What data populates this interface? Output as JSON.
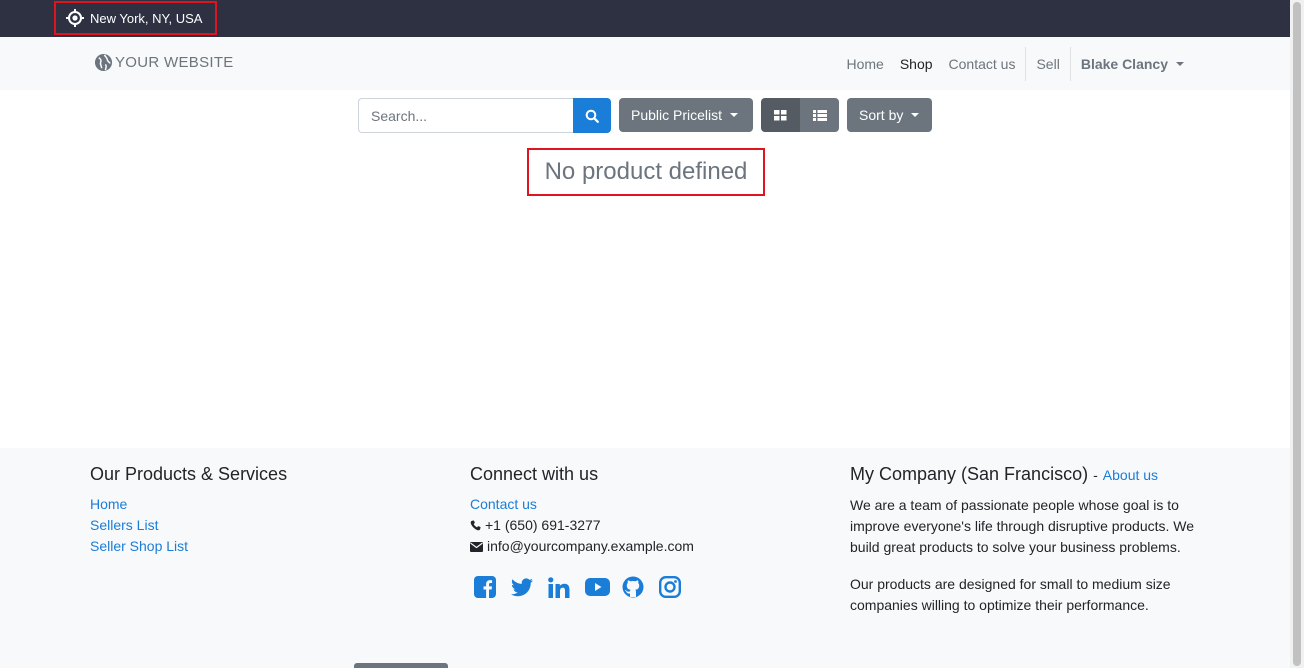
{
  "topbar": {
    "location": "New York, NY, USA"
  },
  "header": {
    "brand": "YOUR WEBSITE",
    "nav": {
      "home": "Home",
      "shop": "Shop",
      "contact": "Contact us",
      "sell": "Sell",
      "user": "Blake Clancy"
    }
  },
  "toolbar": {
    "search_placeholder": "Search...",
    "pricelist": "Public Pricelist",
    "sortby": "Sort by"
  },
  "main": {
    "empty_message": "No product defined"
  },
  "footer": {
    "products": {
      "title": "Our Products & Services",
      "links": [
        "Home",
        "Sellers List",
        "Seller Shop List"
      ]
    },
    "connect": {
      "title": "Connect with us",
      "contact_link": "Contact us",
      "phone": "+1 (650) 691-3277",
      "email": "info@yourcompany.example.com",
      "social_icons": [
        "facebook-icon",
        "twitter-icon",
        "linkedin-icon",
        "youtube-icon",
        "github-icon",
        "instagram-icon"
      ]
    },
    "company": {
      "title": "My Company (San Francisco)",
      "separator": "-",
      "about_link": "About us",
      "para1": "We are a team of passionate people whose goal is to improve everyone's life through disruptive products. We build great products to solve your business problems.",
      "para2": "Our products are designed for small to medium size companies willing to optimize their performance."
    }
  },
  "colors": {
    "accent": "#1a7dd8",
    "topbar": "#2d3142",
    "highlight": "#e0141e",
    "secondary": "#6c757d"
  }
}
